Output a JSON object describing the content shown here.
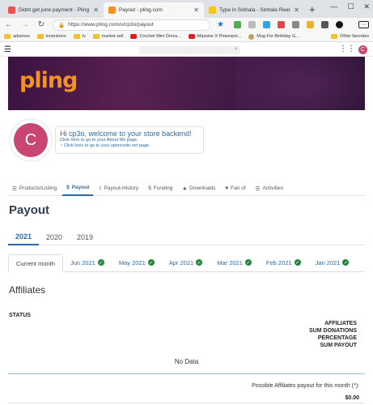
{
  "browser": {
    "tabs": [
      {
        "title": "Didnt get june payment - Pling",
        "active": false,
        "favicon_color": "#e8554e"
      },
      {
        "title": "Payout - pling.com",
        "active": true,
        "favicon_color": "#f39221"
      },
      {
        "title": "Type in Sinhala - Sinhala Real-ti",
        "active": false,
        "favicon_color": "#f5c518"
      }
    ],
    "url": "https://www.pling.com/u/cp3o/payout",
    "bookmarks": [
      "adsense",
      "inventions",
      "tv",
      "market sell",
      "Crochet Mini Dress...",
      "Massive X Powerpoi...",
      "Mug For Birthday G..."
    ],
    "other_favorites": "Other favorites"
  },
  "site": {
    "logo": "pling",
    "user_initial": "C"
  },
  "profile": {
    "initial": "C",
    "hi_prefix": "Hi ",
    "username": "cp3o",
    "hi_suffix": ", welcome to your store backend!",
    "link_about": "Click here to go to your About Me page.",
    "link_opencode": "Click here to go to your opencode.net page."
  },
  "store_tabs": [
    {
      "label": "Products/Listing",
      "icon": "list-icon",
      "active": false
    },
    {
      "label": "Payout",
      "icon": "dollar-icon",
      "active": true
    },
    {
      "label": "Payout-History",
      "icon": "chart-icon",
      "active": false
    },
    {
      "label": "Funding",
      "icon": "dollar-icon",
      "active": false
    },
    {
      "label": "Downloads",
      "icon": "star-icon",
      "active": false
    },
    {
      "label": "Fan of",
      "icon": "heart-icon",
      "active": false
    },
    {
      "label": "Activities",
      "icon": "list-icon",
      "active": false
    }
  ],
  "page_title": "Payout",
  "years": [
    {
      "label": "2021",
      "active": true
    },
    {
      "label": "2020",
      "active": false
    },
    {
      "label": "2019",
      "active": false
    }
  ],
  "months": [
    {
      "label": "Current month",
      "active": true,
      "check": false
    },
    {
      "label": "Jun 2021",
      "active": false,
      "check": true
    },
    {
      "label": "May 2021",
      "active": false,
      "check": true
    },
    {
      "label": "Apr 2021",
      "active": false,
      "check": true
    },
    {
      "label": "Mar 2021",
      "active": false,
      "check": true
    },
    {
      "label": "Feb 2021",
      "active": false,
      "check": true
    },
    {
      "label": "Jan 2021",
      "active": false,
      "check": true
    }
  ],
  "affiliates": {
    "title": "Affiliates",
    "status_header": "STATUS",
    "right_headers": [
      "AFFILIATES",
      "SUM DONATIONS",
      "PERCENTAGE",
      "SUM PAYOUT"
    ],
    "no_data": "No Data",
    "possible_label": "Possible Affiliates payout for this month (*):",
    "total": "$0.00"
  },
  "colors": {
    "accent": "#2a6ca5",
    "logo_orange": "#f39221",
    "avatar_pink": "#c94671",
    "check_green": "#1f8b3a"
  }
}
